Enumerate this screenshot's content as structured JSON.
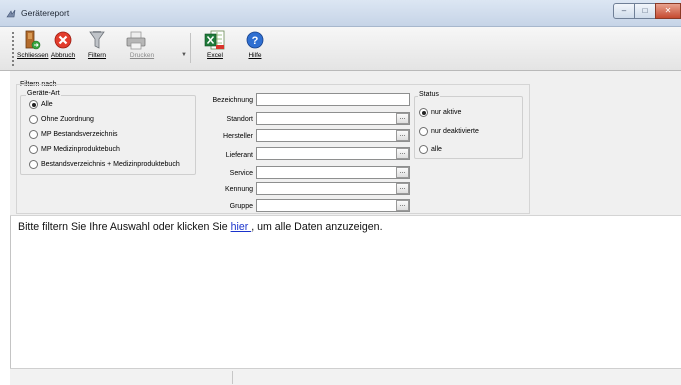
{
  "window": {
    "title": "Gerätereport",
    "minimize_glyph": "–",
    "maximize_glyph": "□",
    "close_glyph": "✕"
  },
  "toolbar": {
    "buttons": [
      {
        "label": "Schliessen",
        "icon": "exit-door-icon",
        "enabled": true
      },
      {
        "label": "Abbruch",
        "icon": "cancel-icon",
        "enabled": true
      },
      {
        "label": "Filtern",
        "icon": "filter-icon",
        "enabled": true
      },
      {
        "label": "Drucken",
        "icon": "printer-icon",
        "enabled": false
      },
      {
        "label": "Excel",
        "icon": "excel-icon",
        "enabled": true
      },
      {
        "label": "Hilfe",
        "icon": "help-icon",
        "enabled": true
      }
    ],
    "dropdown_glyph": "▼"
  },
  "filter": {
    "title": "Filtern nach",
    "device_type": {
      "legend": "Geräte-Art",
      "options": [
        {
          "label": "Alle",
          "selected": true
        },
        {
          "label": "Ohne Zuordnung",
          "selected": false
        },
        {
          "label": "MP Bestandsverzeichnis",
          "selected": false
        },
        {
          "label": "MP Medizinproduktebuch",
          "selected": false
        },
        {
          "label": "Bestandsverzeichnis + Medizinproduktebuch",
          "selected": false
        }
      ]
    },
    "fields": [
      {
        "label": "Bezeichnung",
        "value": "",
        "has_picker": false
      },
      {
        "label": "Standort",
        "value": "",
        "has_picker": true
      },
      {
        "label": "Hersteller",
        "value": "",
        "has_picker": true
      },
      {
        "label": "Lieferant",
        "value": "",
        "has_picker": true
      },
      {
        "label": "Service",
        "value": "",
        "has_picker": true
      },
      {
        "label": "Kennung",
        "value": "",
        "has_picker": true
      },
      {
        "label": "Gruppe",
        "value": "",
        "has_picker": true
      }
    ],
    "picker_glyph": "...",
    "status": {
      "legend": "Status",
      "options": [
        {
          "label": "nur aktive",
          "selected": true
        },
        {
          "label": "nur deaktivierte",
          "selected": false
        },
        {
          "label": "alle",
          "selected": false
        }
      ]
    }
  },
  "message": {
    "before": "Bitte filtern Sie Ihre Auswahl oder klicken Sie ",
    "link": " hier ",
    "after": ", um alle Daten anzuzeigen."
  },
  "colors": {
    "link": "#1a33cc",
    "titlebar": "#c6d4e7",
    "close_button": "#c54a30"
  }
}
